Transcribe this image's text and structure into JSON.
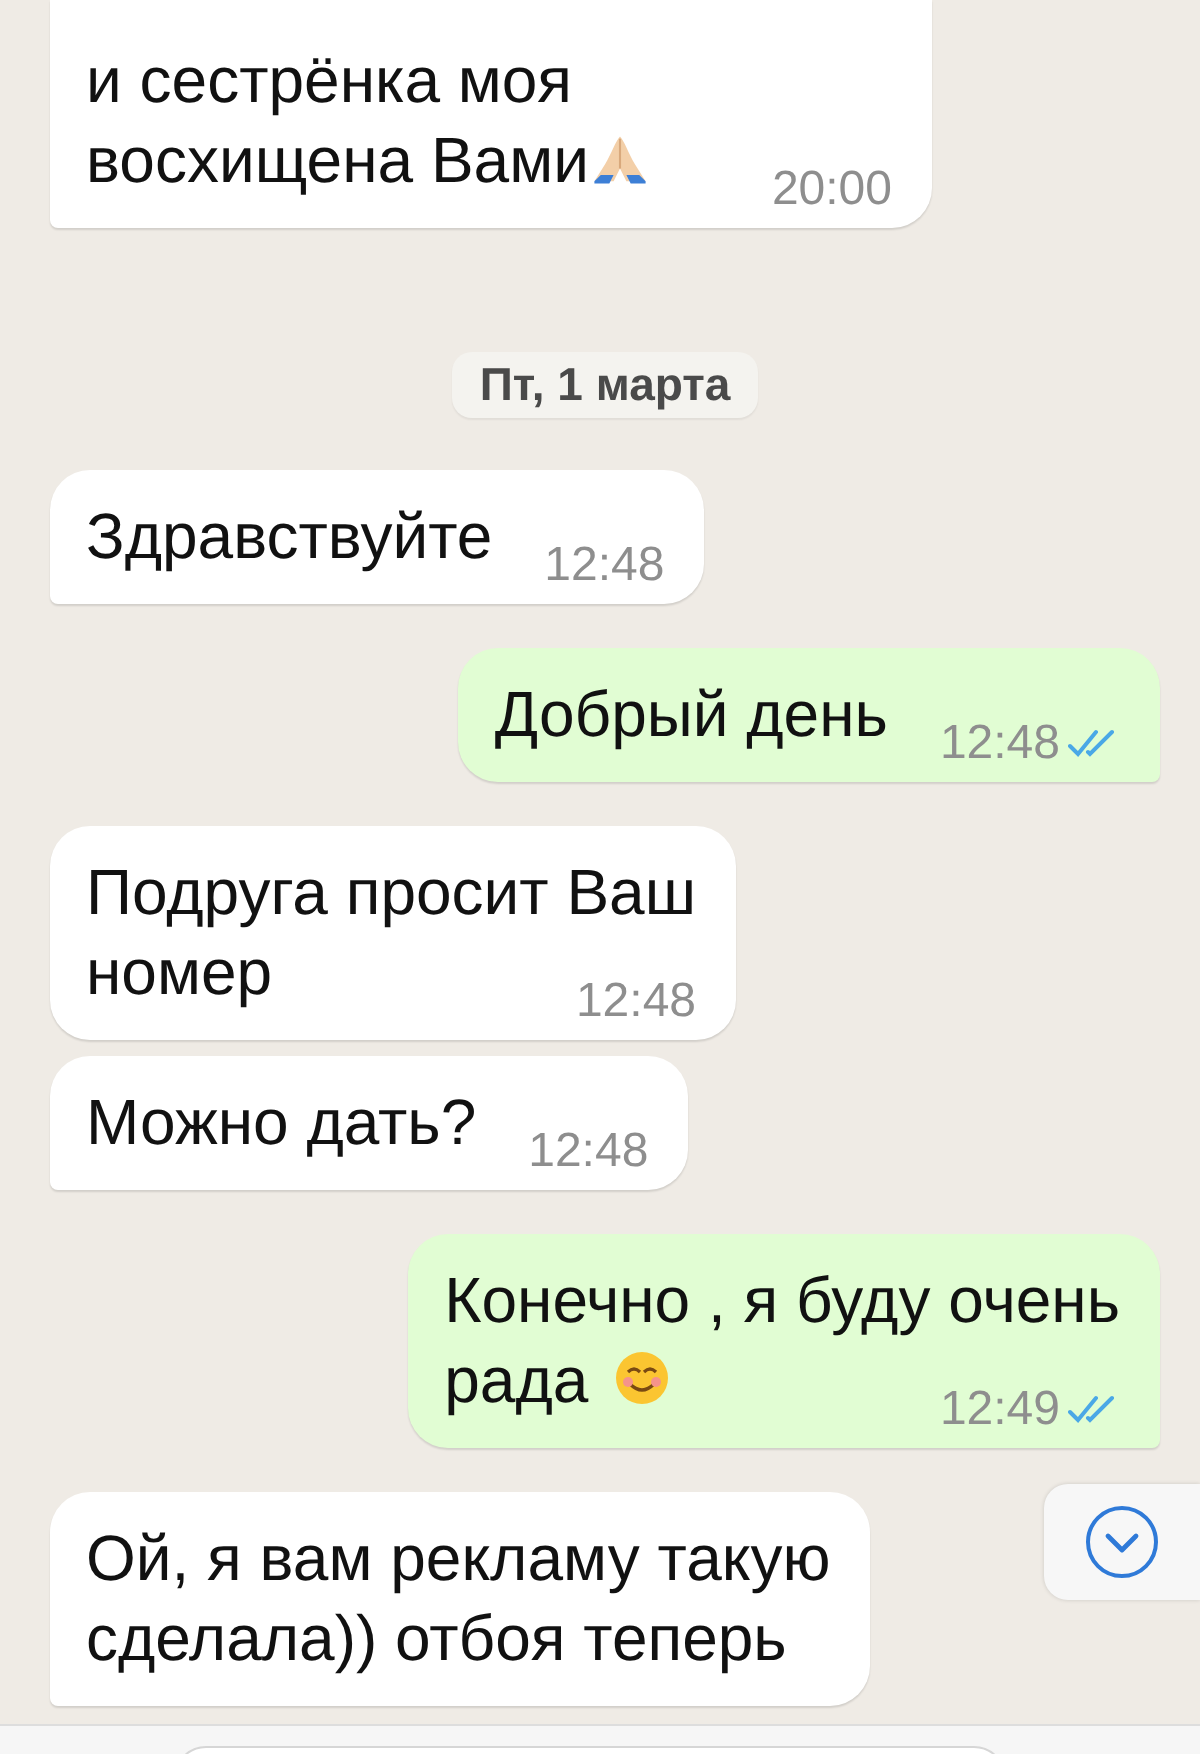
{
  "messages": [
    {
      "kind": "message",
      "outgoing": false,
      "lines": [
        "и сестрёнка моя",
        "восхищена Вами"
      ],
      "emoji": {
        "kind": "pray"
      },
      "time": "20:00"
    },
    {
      "kind": "date",
      "text": "Пт, 1 марта"
    },
    {
      "kind": "message",
      "outgoing": false,
      "lines": [
        "Здравствуйте"
      ],
      "time": "12:48"
    },
    {
      "kind": "message",
      "outgoing": true,
      "lines": [
        "Добрый день"
      ],
      "time": "12:48",
      "read": true
    },
    {
      "kind": "message",
      "outgoing": false,
      "lines": [
        "Подруга просит Ваш",
        "номер"
      ],
      "time": "12:48"
    },
    {
      "kind": "message",
      "outgoing": false,
      "lines": [
        "Можно дать?"
      ],
      "time": "12:48"
    },
    {
      "kind": "message",
      "outgoing": true,
      "lines": [
        "Конечно , я буду очень",
        "рада"
      ],
      "emoji": {
        "kind": "smile"
      },
      "time": "12:49",
      "read": true
    },
    {
      "kind": "message",
      "outgoing": false,
      "lines": [
        "Ой, я вам рекламу такую",
        "сделала)) отбоя теперь"
      ]
    }
  ]
}
